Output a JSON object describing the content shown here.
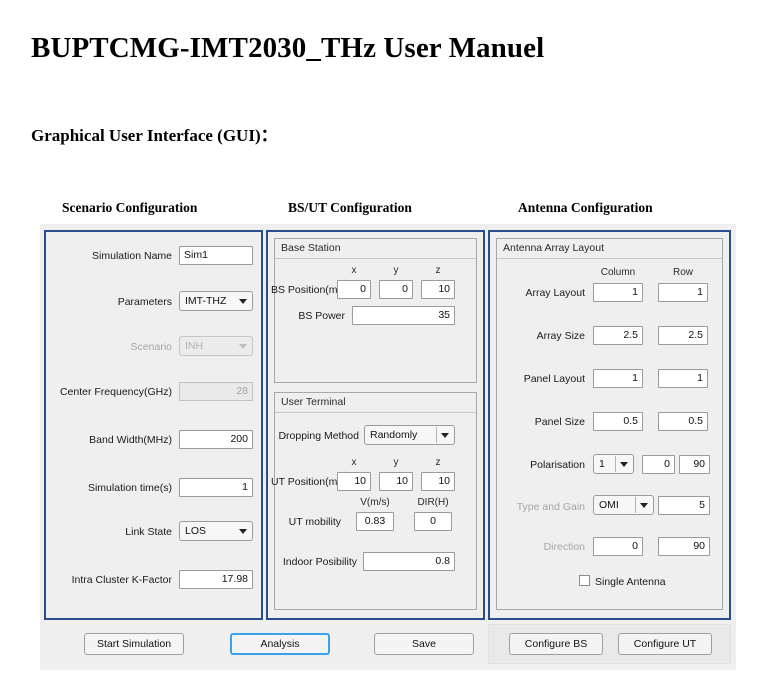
{
  "document": {
    "title": "BUPTCMG-IMT2030_THz User Manuel",
    "subtitle": "Graphical User Interface (GUI)："
  },
  "column_captions": [
    "Scenario Configuration",
    "BS/UT Configuration",
    "Antenna Configuration"
  ],
  "scenario_panel": {
    "simulation_name": {
      "label": "Simulation Name",
      "value": "Sim1"
    },
    "parameters": {
      "label": "Parameters",
      "value": "IMT-THZ"
    },
    "scenario": {
      "label": "Scenario",
      "value": "INH"
    },
    "center_frequency": {
      "label": "Center Frequency(GHz)",
      "value": "28"
    },
    "band_width": {
      "label": "Band Width(MHz)",
      "value": "200"
    },
    "simulation_time": {
      "label": "Simulation time(s)",
      "value": "1"
    },
    "link_state": {
      "label": "Link State",
      "value": "LOS"
    },
    "k_factor": {
      "label": "Intra Cluster K-Factor",
      "value": "17.98"
    }
  },
  "bs_ut_panel": {
    "base_station": {
      "group_title": "Base Station",
      "axis_headers": [
        "x",
        "y",
        "z"
      ],
      "bs_position": {
        "label": "BS Position(m)",
        "x": "0",
        "y": "0",
        "z": "10"
      },
      "bs_power": {
        "label": "BS Power",
        "value": "35"
      }
    },
    "user_terminal": {
      "group_title": "User Terminal",
      "dropping_method": {
        "label": "Dropping Method",
        "value": "Randomly"
      },
      "axis_headers": [
        "x",
        "y",
        "z"
      ],
      "ut_position": {
        "label": "UT Position(m)",
        "x": "10",
        "y": "10",
        "z": "10"
      },
      "mobility_headers": [
        "V(m/s)",
        "DIR(H)"
      ],
      "ut_mobility": {
        "label": "UT mobility",
        "v": "0.83",
        "dir": "0"
      },
      "indoor_possibility": {
        "label": "Indoor Posibility",
        "value": "0.8"
      }
    }
  },
  "antenna_panel": {
    "group_title": "Antenna Array Layout",
    "column_headers": [
      "Column",
      "Row"
    ],
    "array_layout": {
      "label": "Array Layout",
      "column": "1",
      "row": "1"
    },
    "array_size": {
      "label": "Array Size",
      "column": "2.5",
      "row": "2.5"
    },
    "panel_layout": {
      "label": "Panel Layout",
      "column": "1",
      "row": "1"
    },
    "panel_size": {
      "label": "Panel Size",
      "column": "0.5",
      "row": "0.5"
    },
    "polarisation": {
      "label": "Polarisation",
      "select": "1",
      "field1": "0",
      "field2": "90"
    },
    "type_and_gain": {
      "label": "Type and Gain",
      "select": "OMI",
      "gain": "5"
    },
    "direction": {
      "label": "Direction",
      "field1": "0",
      "field2": "90"
    },
    "single_antenna": {
      "label": "Single Antenna"
    }
  },
  "buttons": {
    "start_simulation": "Start Simulation",
    "analysis": "Analysis",
    "save": "Save",
    "configure_bs": "Configure BS",
    "configure_ut": "Configure UT"
  },
  "colors": {
    "panel_border": "#2b4d8e",
    "figure_background": "#efefef",
    "focus_outline": "#39a0ed"
  }
}
